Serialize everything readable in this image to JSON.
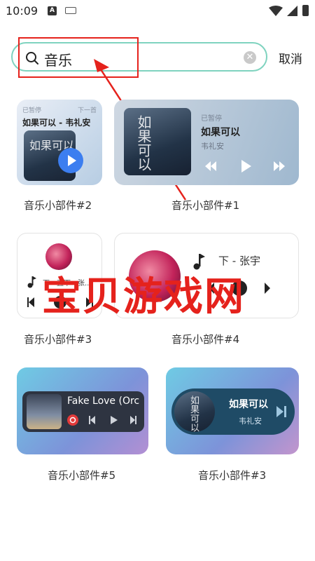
{
  "status_bar": {
    "time": "10:09",
    "notification_icons": [
      "a-icon",
      "keyboard-icon"
    ],
    "right_icons": [
      "wifi-icon",
      "signal-icon",
      "battery-icon"
    ]
  },
  "search": {
    "query": "音乐",
    "cancel_label": "取消"
  },
  "colors": {
    "accent_border": "#7fd3bf",
    "annotation_red": "#e5221c"
  },
  "widgets": [
    {
      "label": "音乐小部件#2",
      "status": "已暂停",
      "next": "下一首",
      "song": "如果可以 - 韦礼安",
      "art_text": "如果可以"
    },
    {
      "label": "音乐小部件#1",
      "status": "已暂停",
      "song": "如果可以",
      "artist": "韦礼安",
      "art_text": "如果可以"
    },
    {
      "label": "音乐小部件#3",
      "track_text": "下一直下 - 张..."
    },
    {
      "label": "音乐小部件#4",
      "track_text": "下 - 张宇"
    },
    {
      "label": "音乐小部件#5",
      "song": "Fake Love (Orc"
    },
    {
      "label": "音乐小部件#3",
      "song": "如果可以",
      "artist": "韦礼安",
      "art_text": "如果可以"
    }
  ],
  "watermark": "宝贝游戏网"
}
